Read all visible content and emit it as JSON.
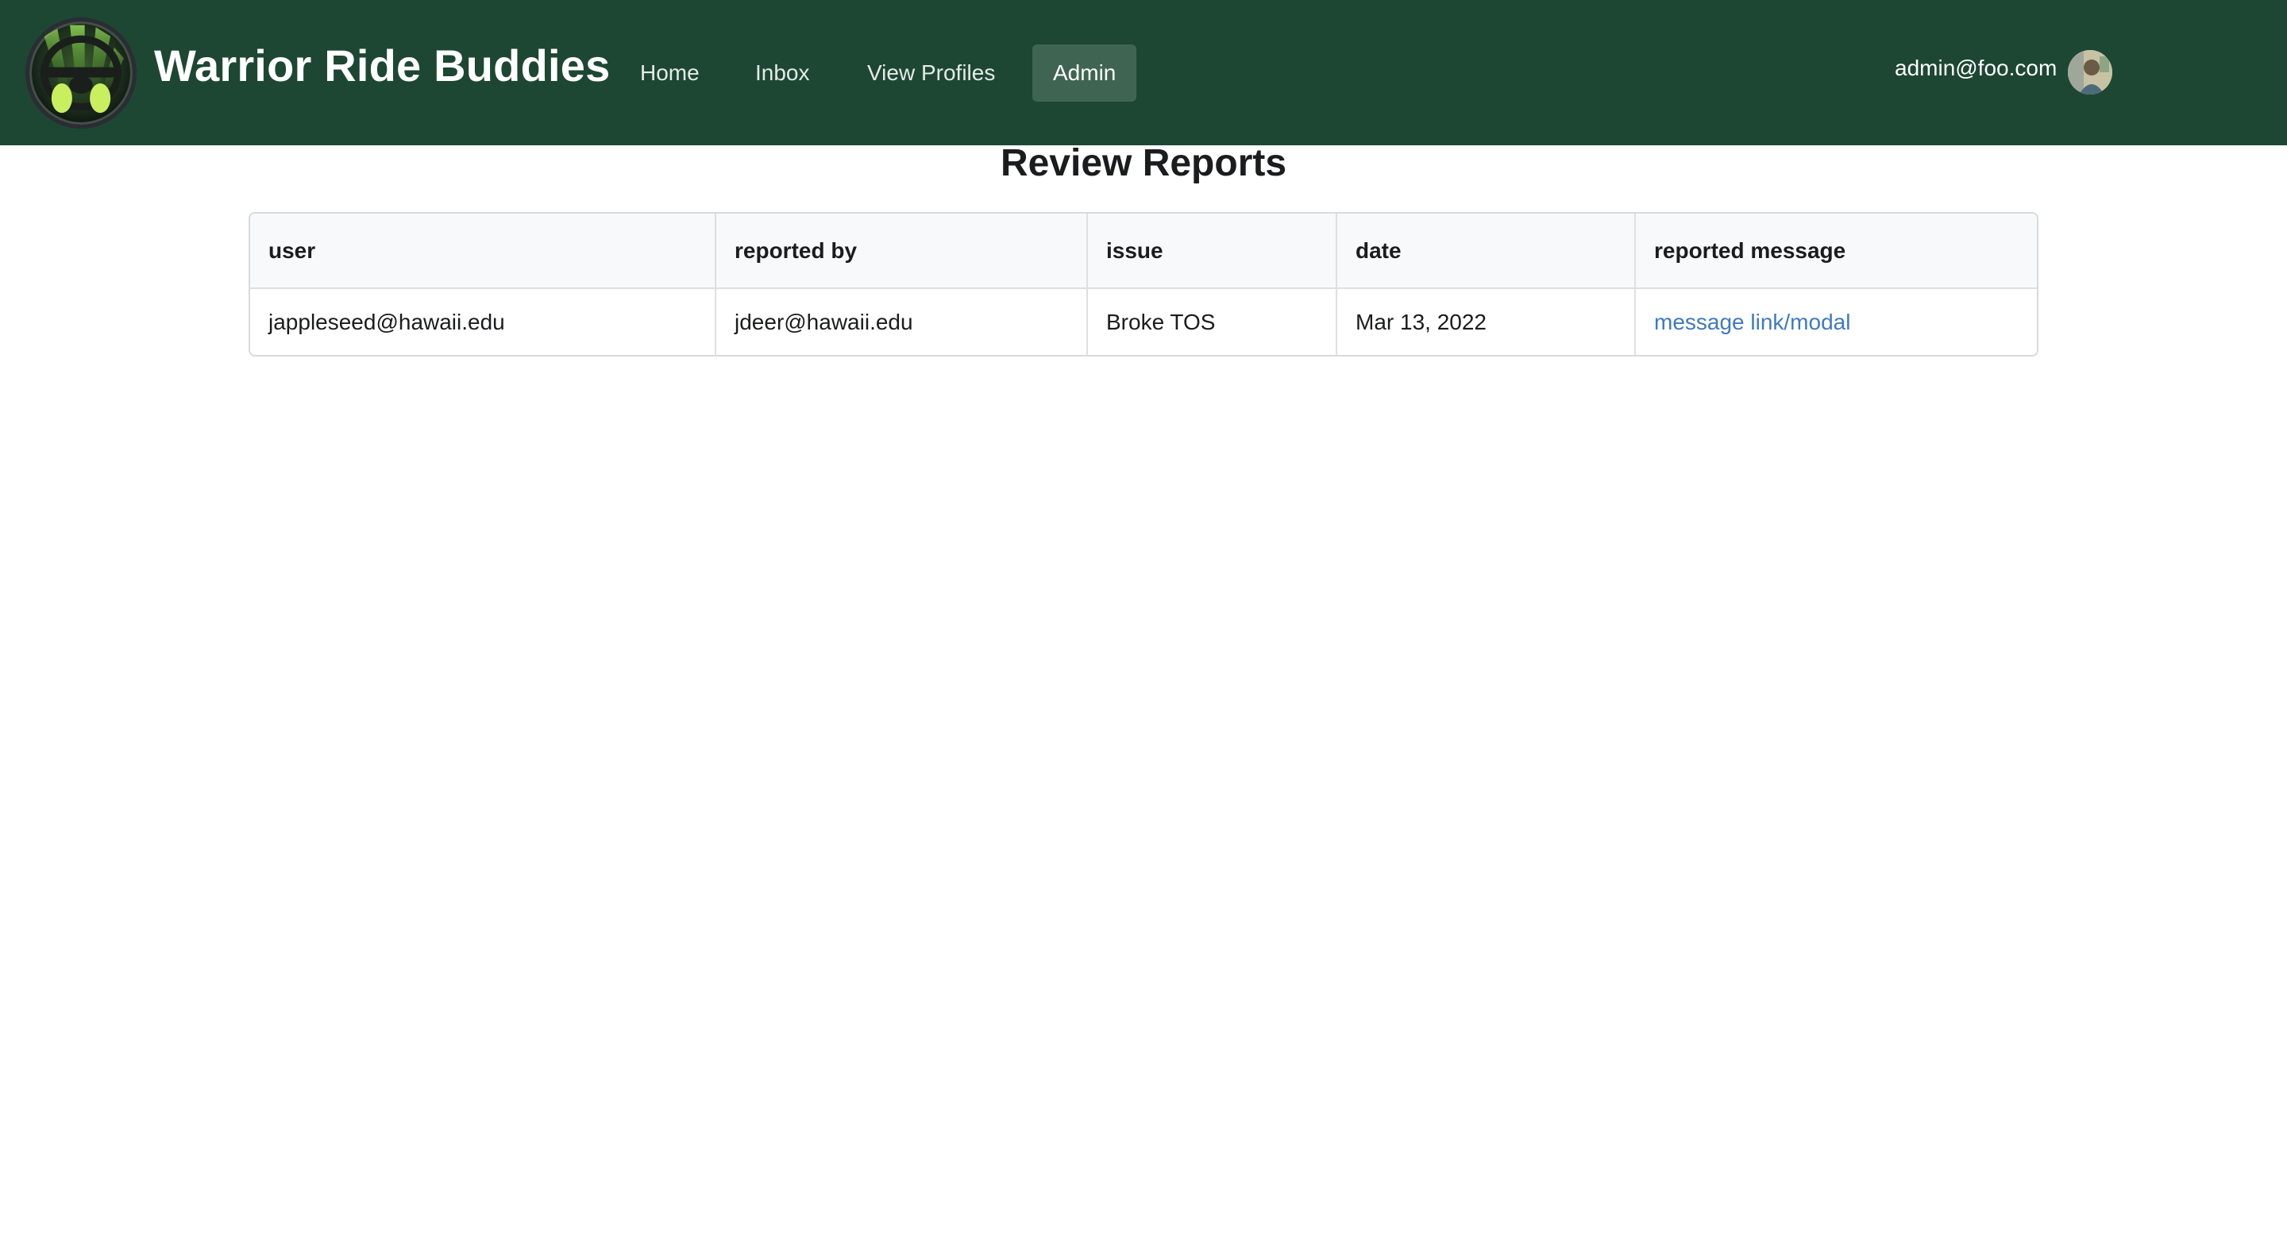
{
  "navbar": {
    "brand": "Warrior Ride Buddies",
    "logo_icon": "steering-wheel-logo",
    "items": [
      {
        "label": "Home",
        "active": false
      },
      {
        "label": "Inbox",
        "active": false
      },
      {
        "label": "View Profiles",
        "active": false
      },
      {
        "label": "Admin",
        "active": true
      }
    ],
    "user_email": "admin@foo.com",
    "avatar_icon": "user-avatar",
    "colors": {
      "background": "#1d4733",
      "active_item": "#3f6552"
    }
  },
  "main": {
    "title": "Review Reports",
    "table": {
      "columns": [
        "user",
        "reported by",
        "issue",
        "date",
        "reported message"
      ],
      "rows": [
        {
          "user": "jappleseed@hawaii.edu",
          "reported_by": "jdeer@hawaii.edu",
          "issue": "Broke TOS",
          "date": "Mar 13, 2022",
          "reported_message": "message link/modal"
        }
      ]
    },
    "link_color": "#3f79c0"
  }
}
